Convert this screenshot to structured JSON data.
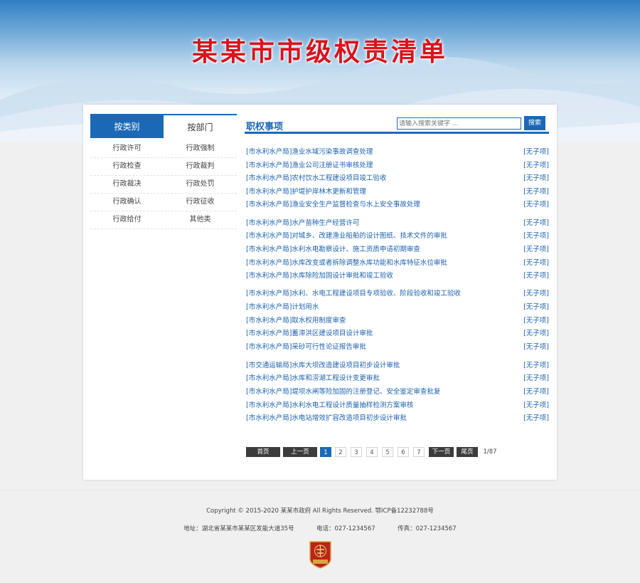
{
  "header": {
    "title": "某某市市级权责清单"
  },
  "tabs": [
    {
      "label": "按类别"
    },
    {
      "label": "按部门"
    }
  ],
  "categories": [
    [
      "行政许可",
      "行政强制"
    ],
    [
      "行政检查",
      "行政裁判"
    ],
    [
      "行政裁决",
      "行政处罚"
    ],
    [
      "行政确认",
      "行政征收"
    ],
    [
      "行政给付",
      "其他类"
    ]
  ],
  "section": {
    "title": "职权事项"
  },
  "search": {
    "placeholder": "请输入搜索关键字 ...",
    "button": "搜索"
  },
  "items": [
    {
      "title": "[市水利水产局]渔业水域污染事故调查处理",
      "link": "[无子项]"
    },
    {
      "title": "[市水利水产局]渔业公司注册证书审核处理",
      "link": "[无子项]"
    },
    {
      "title": "[市水利水产局]农村饮水工程建设项目竣工验收",
      "link": "[无子项]"
    },
    {
      "title": "[市水利水产局]护堤护岸林木更新和管理",
      "link": "[无子项]"
    },
    {
      "title": "[市水利水产局]渔业安全生产监督检查与水上安全事故处理",
      "link": "[无子项]"
    },
    {
      "title": "[市水利水产局]水产苗种生产经营许可",
      "link": "[无子项]"
    },
    {
      "title": "[市水利水产局]对城乡、改建渔业船舶的设计图纸、技术文件的审批",
      "link": "[无子项]"
    },
    {
      "title": "[市水利水产局]水利水电勘察设计、施工资质申请初期审查",
      "link": "[无子项]"
    },
    {
      "title": "[市水利水产局]水库改变或者拆除调整水库功能和水库特征水位审批",
      "link": "[无子项]"
    },
    {
      "title": "[市水利水产局]水库除险加固设计审批和竣工验收",
      "link": "[无子项]"
    },
    {
      "title": "[市水利水产局]水利、水电工程建设项目专项验收、阶段验收和竣工验收",
      "link": "[无子项]"
    },
    {
      "title": "[市水利水产局]计划用水",
      "link": "[无子项]"
    },
    {
      "title": "[市水利水产局]取水权用制度审查",
      "link": "[无子项]"
    },
    {
      "title": "[市水利水产局]蓄滞洪区建设项目设计审批",
      "link": "[无子项]"
    },
    {
      "title": "[市水利水产局]采砂可行性论证报告审批",
      "link": "[无子项]"
    },
    {
      "title": "[市交通运输局]水库大坝改造建设项目初步设计审批",
      "link": "[无子项]"
    },
    {
      "title": "[市水利水产局]水库和涝湖工程设计变更审批",
      "link": "[无子项]"
    },
    {
      "title": "[市水利水产局]堤坝水闸等险加固的注册登记、安全鉴定审查批复",
      "link": "[无子项]"
    },
    {
      "title": "[市水利水产局]水利水电工程设计质量抽样检测方案审核",
      "link": "[无子项]"
    },
    {
      "title": "[市水利水产局]水电站增效扩容改造项目初步设计审批",
      "link": "[无子项]"
    }
  ],
  "pager": {
    "first": "首页",
    "prev": "上一页",
    "pages": [
      "1",
      "2",
      "3",
      "4",
      "5",
      "6",
      "7"
    ],
    "next": "下一页",
    "last": "尾页",
    "info": "1/87"
  },
  "footer": {
    "copyright": "Copyright © 2015-2020 某某市政府 All Rights Reserved. 鄂ICP备12232788号",
    "address": "地址：湖北省某某市某某区发能大道35号",
    "phone": "电话：027-1234567",
    "fax": "传真：027-1234567",
    "emblem_text": "权力阳光"
  },
  "colors": {
    "accent": "#1b69b6",
    "title_red": "#d9131d",
    "link": "#1b62b0"
  }
}
